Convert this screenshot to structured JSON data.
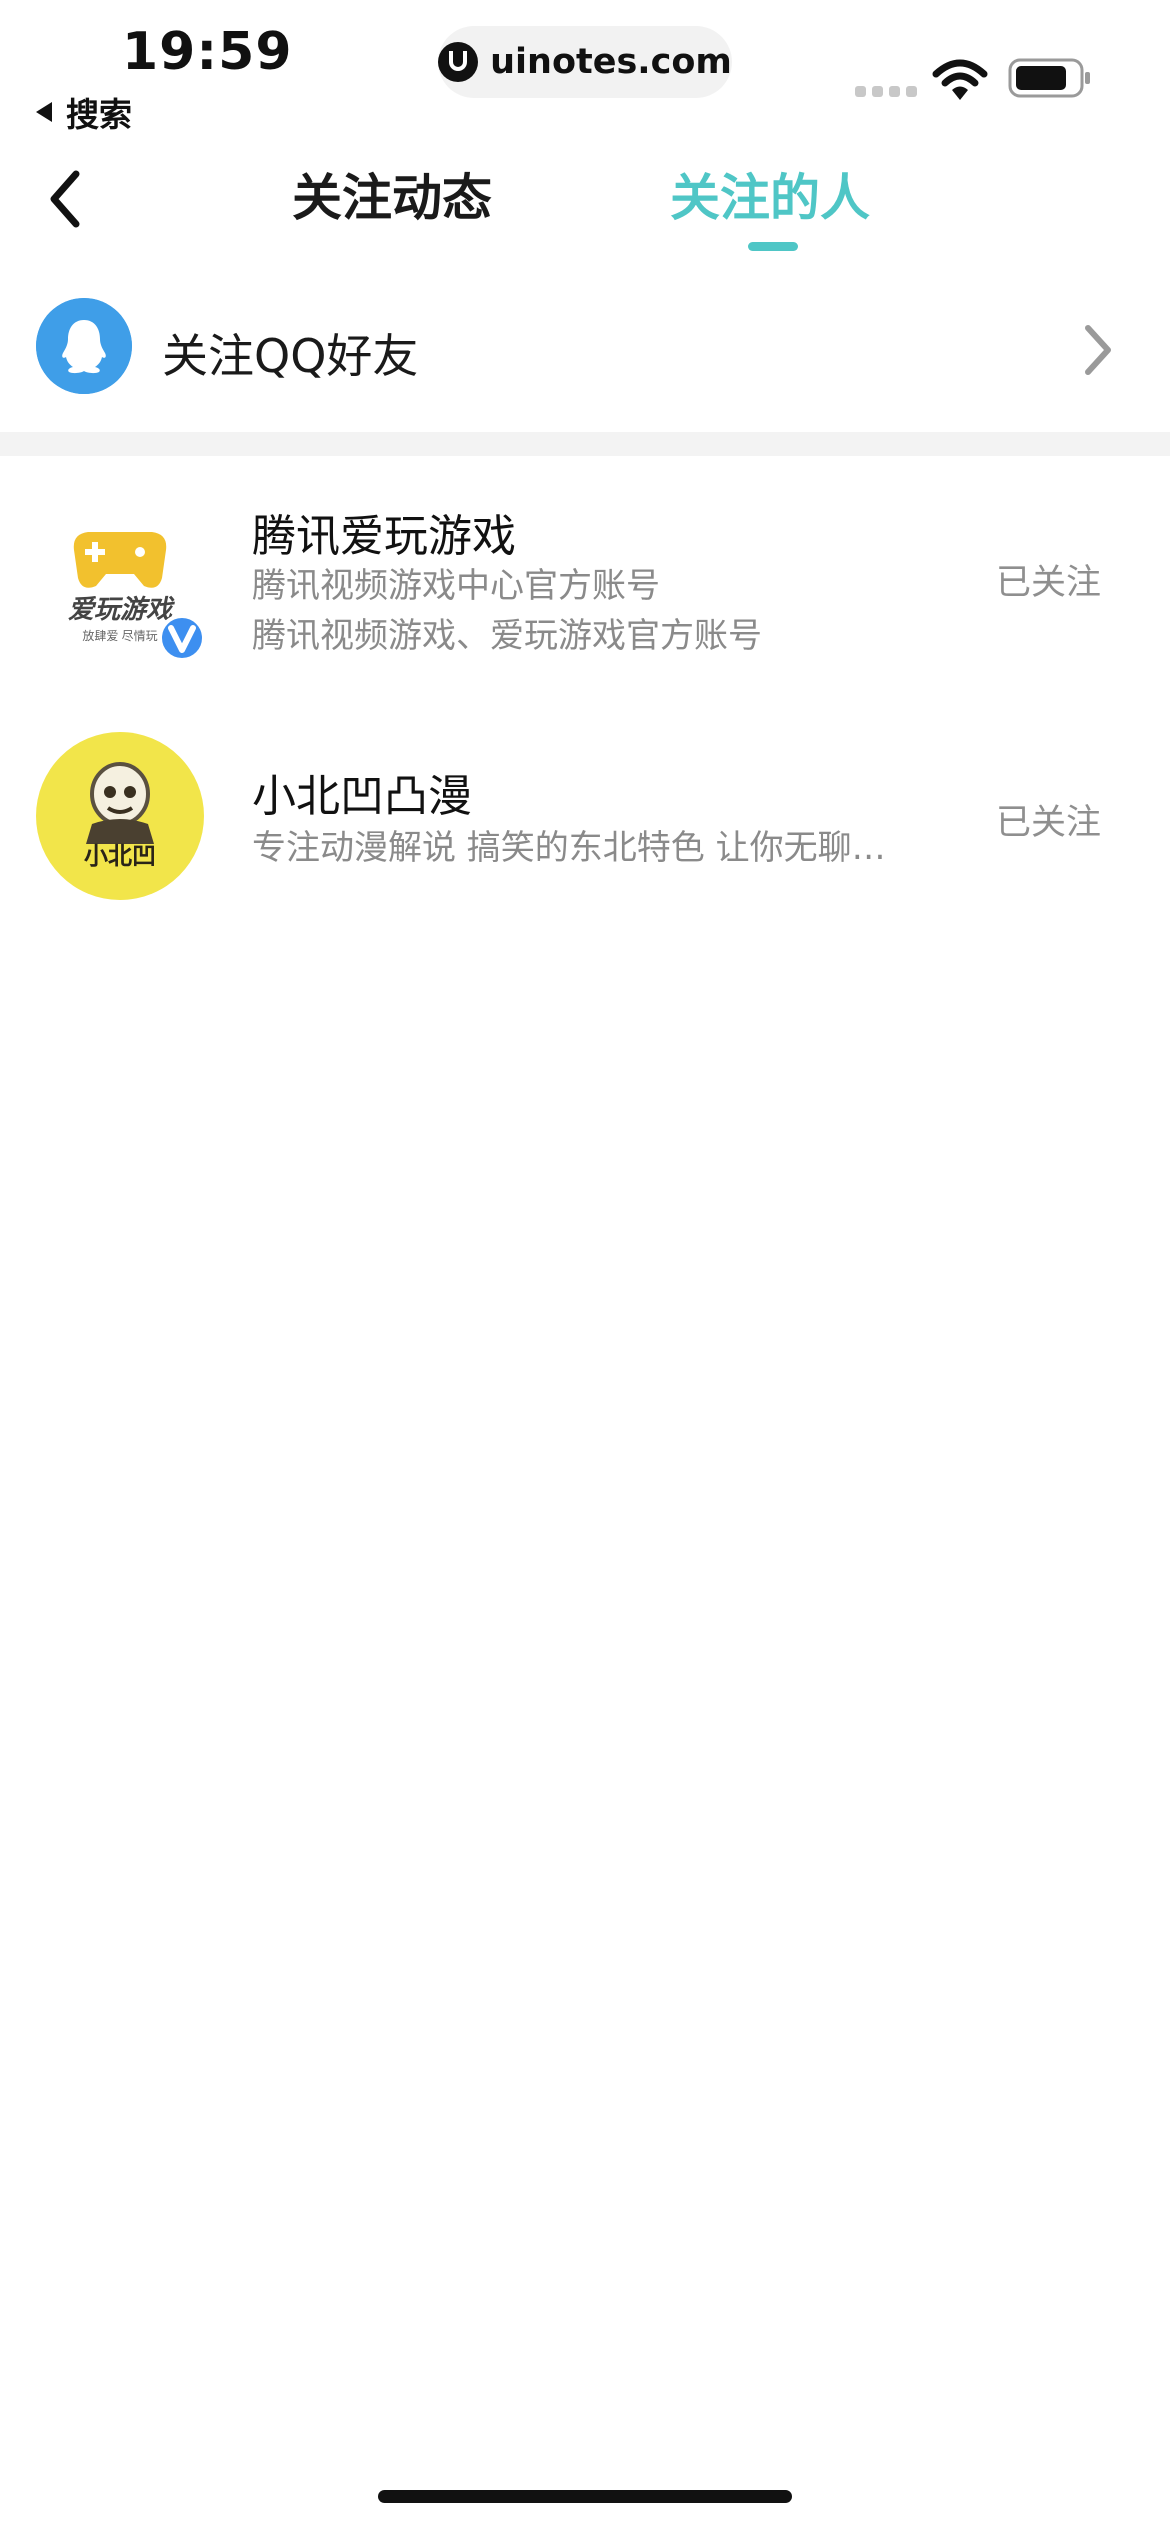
{
  "status_bar": {
    "time": "19:59",
    "back_app_label": "搜索",
    "url": "uinotes.com"
  },
  "nav": {
    "tabs": [
      {
        "label": "关注动态",
        "active": false
      },
      {
        "label": "关注的人",
        "active": true
      }
    ]
  },
  "qq_friends": {
    "label": "关注QQ好友"
  },
  "followed": [
    {
      "name": "腾讯爱玩游戏",
      "desc_lines": [
        "腾讯视频游戏中心官方账号",
        "腾讯视频游戏、爱玩游戏官方账号"
      ],
      "status": "已关注",
      "avatar_text": "爱玩游戏",
      "avatar_subtext": "放肆爱 尽情玩",
      "verified": true
    },
    {
      "name": "小北凹凸漫",
      "desc_lines": [
        "专注动漫解说 搞笑的东北特色 让你无聊…"
      ],
      "status": "已关注",
      "avatar_text": "小北凹",
      "verified": false
    }
  ],
  "colors": {
    "accent": "#4fc6c6",
    "qq_blue": "#3f9ee8",
    "verified_blue": "#3d8ff0",
    "avatar_yellow": "#f2e54a"
  }
}
